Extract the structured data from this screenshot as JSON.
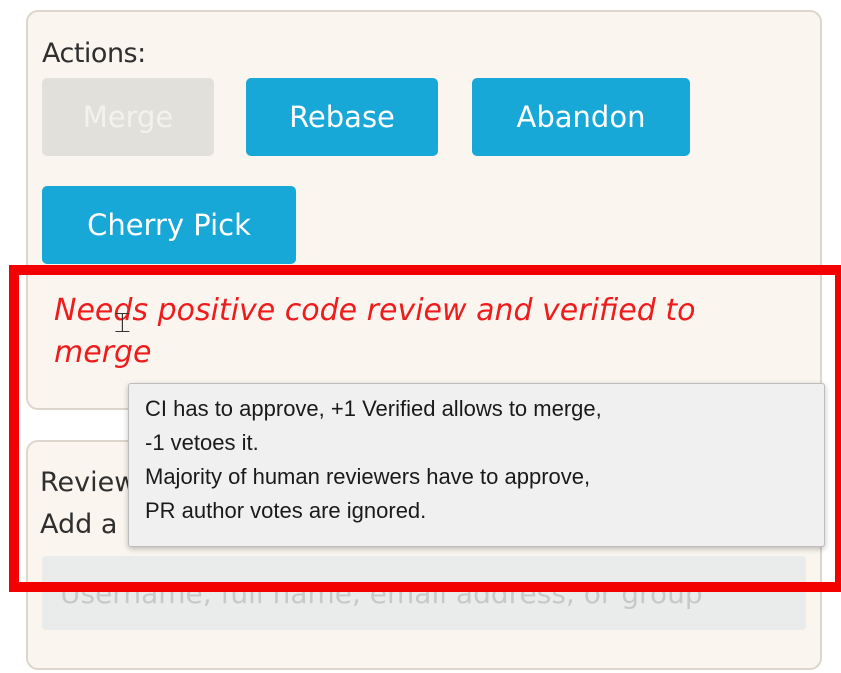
{
  "actions": {
    "heading": "Actions:",
    "buttons": {
      "merge": "Merge",
      "rebase": "Rebase",
      "abandon": "Abandon",
      "cherry_pick": "Cherry Pick"
    }
  },
  "status_message": {
    "line1": "Needs positive code review and verified to",
    "line2": "merge"
  },
  "tooltip": {
    "line1": "CI has to approve, +1 Verified allows to merge,",
    "line2": "-1 vetoes it.",
    "line3": "Majority of human reviewers have to approve,",
    "line4": "PR author votes are ignored."
  },
  "reviewers": {
    "label_line1": "Reviewers:",
    "label_line2": "Add a reviewer",
    "input_placeholder": "Username, full name, email address, or group"
  },
  "colors": {
    "accent": "#18a8d8",
    "disabled": "#e2e0da",
    "status_text": "#ee1c1c",
    "highlight_box": "#f30000"
  },
  "icons": {
    "cursor": "text-cursor-icon"
  }
}
